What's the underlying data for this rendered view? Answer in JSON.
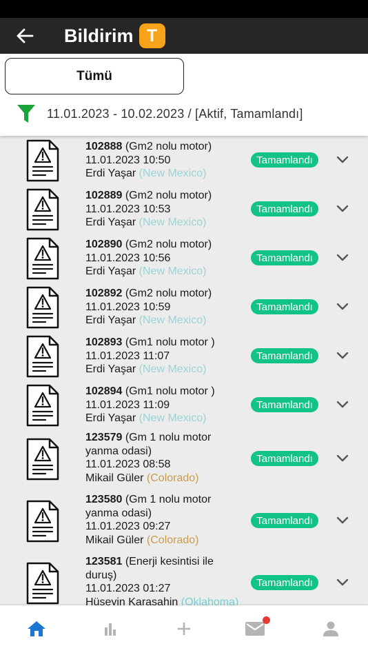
{
  "header": {
    "title": "Bildirim",
    "badge": "T",
    "back_icon": "arrow-left-icon"
  },
  "filter": {
    "tab_all": "Tümü",
    "summary": "11.01.2023 - 10.02.2023 / [Aktif, Tamamlandı]",
    "icon": "filter-icon",
    "icon_color": "#19a33a"
  },
  "notifications": [
    {
      "id": "102888",
      "subject": "(Gm2 nolu motor)",
      "datetime": "11.01.2023 10:50",
      "person": "Erdi Yaşar",
      "location": "(New Mexico)",
      "status": "Tamamlandı"
    },
    {
      "id": "102889",
      "subject": "(Gm2 nolu motor)",
      "datetime": "11.01.2023 10:53",
      "person": "Erdi Yaşar",
      "location": "(New Mexico)",
      "status": "Tamamlandı"
    },
    {
      "id": "102890",
      "subject": "(Gm2 nolu motor)",
      "datetime": "11.01.2023 10:56",
      "person": "Erdi Yaşar",
      "location": "(New Mexico)",
      "status": "Tamamlandı"
    },
    {
      "id": "102892",
      "subject": "(Gm2 nolu motor)",
      "datetime": "11.01.2023 10:59",
      "person": "Erdi Yaşar",
      "location": "(New Mexico)",
      "status": "Tamamlandı"
    },
    {
      "id": "102893",
      "subject": "(Gm1 nolu motor )",
      "datetime": "11.01.2023 11:07",
      "person": "Erdi Yaşar",
      "location": "(New Mexico)",
      "status": "Tamamlandı"
    },
    {
      "id": "102894",
      "subject": "(Gm1 nolu motor )",
      "datetime": "11.01.2023 11:09",
      "person": "Erdi Yaşar",
      "location": "(New Mexico)",
      "status": "Tamamlandı"
    },
    {
      "id": "123579",
      "subject": "(Gm 1 nolu motor yanma odasi)",
      "datetime": "11.01.2023 08:58",
      "person": "Mikail Güler",
      "location": "(Colorado)",
      "status": "Tamamlandı"
    },
    {
      "id": "123580",
      "subject": "(Gm 1 nolu motor yanma odasi)",
      "datetime": "11.01.2023 09:27",
      "person": "Mikail Güler",
      "location": "(Colorado)",
      "status": "Tamamlandı"
    },
    {
      "id": "123581",
      "subject": "(Enerji kesintisi ile duruş)",
      "datetime": "11.01.2023 01:27",
      "person": "Hüseyin Karaşahin",
      "location": "(Oklahoma)",
      "status": "Tamamlandı"
    }
  ],
  "colors": {
    "appbar": "#262626",
    "badge": "#f7a21b",
    "status": "#12c387",
    "nav_active": "#1976d2",
    "nav_inactive": "#b4b4b4",
    "mail_dot": "#e73a33"
  },
  "bottom_nav": [
    {
      "icon": "home-icon",
      "active": true
    },
    {
      "icon": "bar-chart-icon",
      "active": false
    },
    {
      "icon": "plus-icon",
      "active": false
    },
    {
      "icon": "mail-icon",
      "active": false,
      "has_notification": true
    },
    {
      "icon": "person-icon",
      "active": false
    }
  ]
}
